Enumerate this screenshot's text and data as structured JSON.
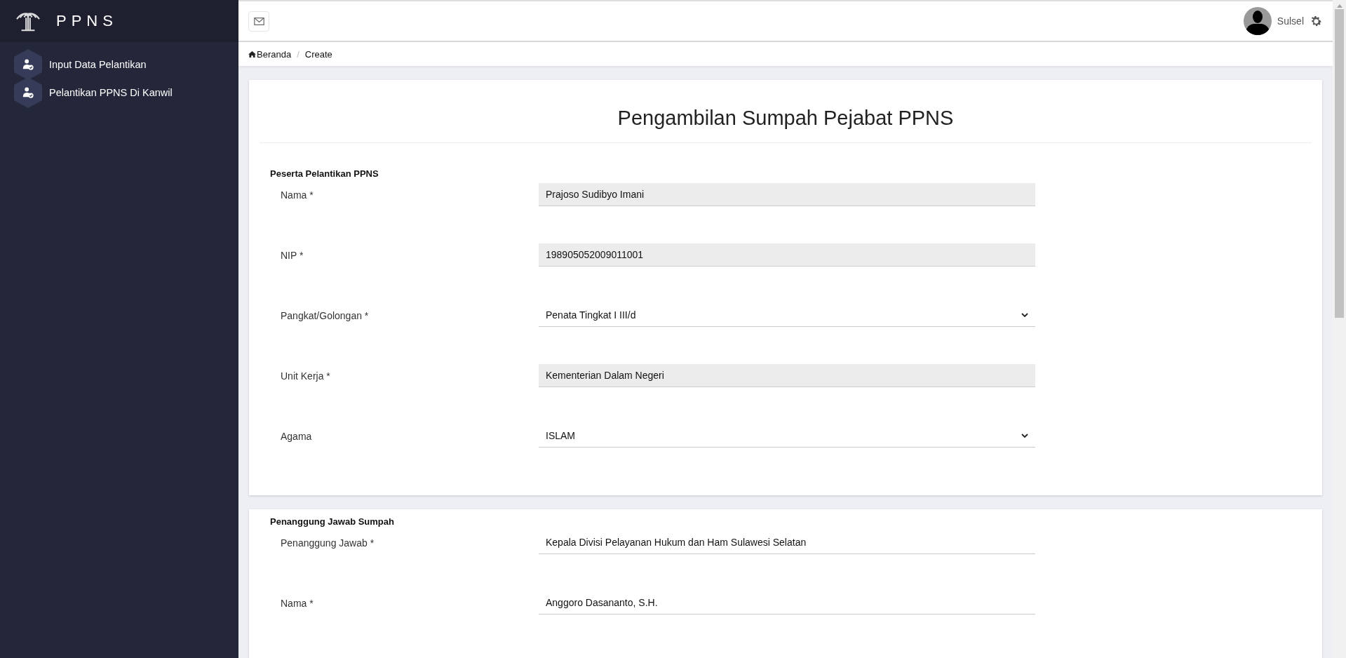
{
  "sidebar": {
    "brand": "PPNS",
    "items": [
      {
        "label": "Input Data Pelantikan",
        "selected": false
      },
      {
        "label": "Pelantikan PPNS Di Kanwil",
        "selected": false
      }
    ]
  },
  "header": {
    "user": "Sulsel"
  },
  "breadcrumb_separator": "/",
  "breadcrumb": [
    {
      "label": "Beranda",
      "kind": "home"
    },
    {
      "label": "Create",
      "kind": "current"
    }
  ],
  "page_title": "Pengambilan Sumpah Pejabat PPNS",
  "sections": [
    {
      "title": "Peserta Pelantikan PPNS",
      "fields": [
        {
          "label": "Nama *",
          "value": "Prajoso Sudibyo Imani",
          "kind": "readonly"
        },
        {
          "label": "NIP *",
          "value": "198905052009011001",
          "kind": "readonly"
        },
        {
          "label": "Pangkat/Golongan *",
          "value": "Penata Tingkat I III/d",
          "kind": "select"
        },
        {
          "label": "Unit Kerja *",
          "value": "Kementerian Dalam Negeri",
          "kind": "readonly"
        },
        {
          "label": "Agama",
          "value": "ISLAM",
          "kind": "select"
        }
      ]
    },
    {
      "title": "Penanggung Jawab Sumpah",
      "fields": [
        {
          "label": "Penanggung Jawab *",
          "value": "Kepala Divisi Pelayanan Hukum dan Ham Sulawesi Selatan",
          "kind": "text"
        },
        {
          "label": "Nama *",
          "value": "Anggoro Dasananto, S.H.",
          "kind": "text"
        }
      ]
    }
  ]
}
